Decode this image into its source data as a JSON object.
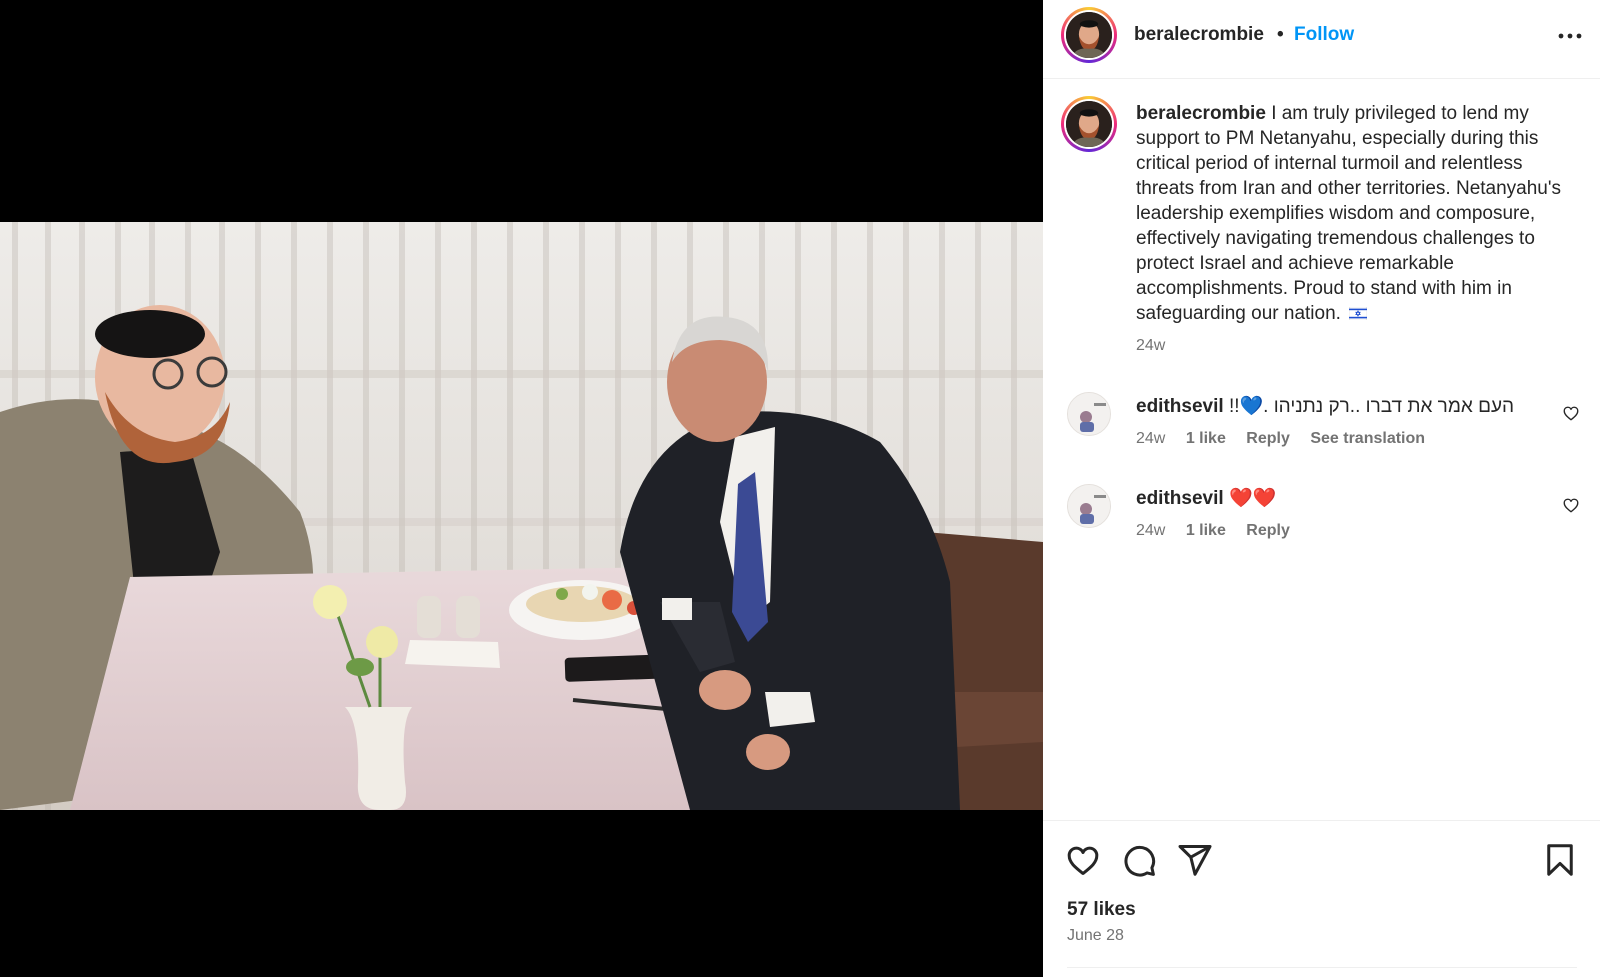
{
  "header": {
    "username": "beralecrombie",
    "separator": "•",
    "follow_label": "Follow"
  },
  "caption": {
    "username": "beralecrombie",
    "text": "I am truly privileged to lend my support to PM Netanyahu, especially during this critical period of internal turmoil and relentless threats from Iran and other territories. Netanyahu's leadership exemplifies wisdom and composure, effectively navigating tremendous challenges to protect Israel and achieve remarkable accomplishments. Proud to stand with him in safeguarding our nation.",
    "time": "24w"
  },
  "comments": [
    {
      "username": "edithsevil",
      "text": "!!💙. העם אמר את דברו ..רק נתניהו",
      "time": "24w",
      "likes": "1 like",
      "reply_label": "Reply",
      "translation_label": "See translation"
    },
    {
      "username": "edithsevil",
      "text": "❤️❤️",
      "time": "24w",
      "likes": "1 like",
      "reply_label": "Reply"
    }
  ],
  "footer": {
    "likes": "57 likes",
    "date": "June 28"
  },
  "icons": {
    "more": "more-horizontal-icon",
    "like": "heart-icon",
    "comment": "comment-bubble-icon",
    "share": "paper-plane-icon",
    "save": "bookmark-icon"
  },
  "colors": {
    "link_blue": "#0095f6",
    "secondary_text": "#737373",
    "primary_text": "#262626"
  }
}
